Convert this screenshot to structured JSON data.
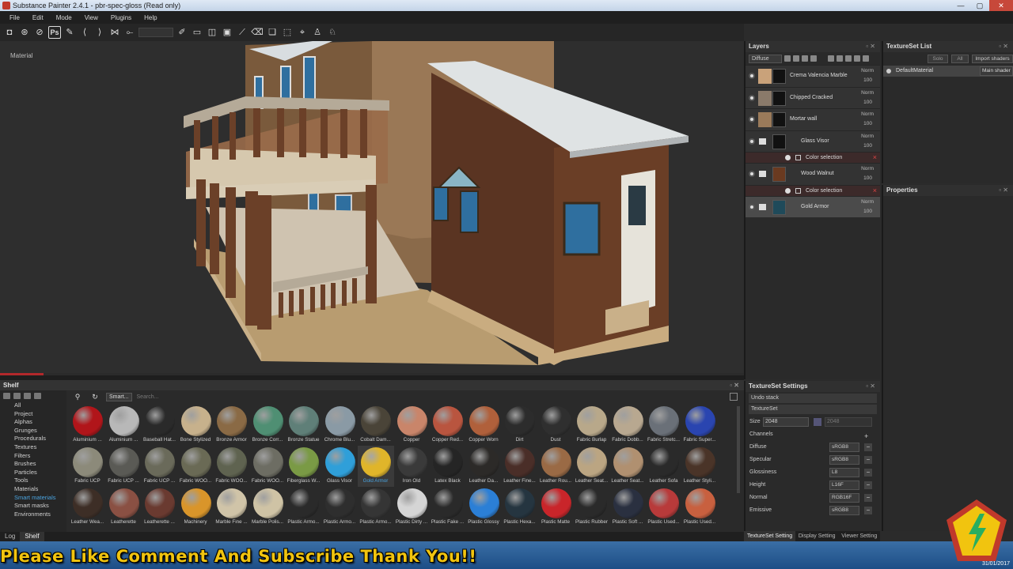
{
  "window": {
    "title": "Substance Painter 2.4.1 - pbr-spec-gloss (Read only)"
  },
  "menu": [
    "File",
    "Edit",
    "Mode",
    "View",
    "Plugins",
    "Help"
  ],
  "toolbar": {
    "photoshop_label": "Ps"
  },
  "viewport": {
    "label": "Material"
  },
  "shelf": {
    "title": "Shelf",
    "filter_chip": "Smart...",
    "search_placeholder": "Search...",
    "categories": [
      "All",
      "Project",
      "Alphas",
      "Grunges",
      "Procedurals",
      "Textures",
      "Filters",
      "Brushes",
      "Particles",
      "Tools",
      "Materials",
      "Smart materials",
      "Smart masks",
      "Environments"
    ],
    "selected_category": "Smart materials",
    "materials": [
      {
        "name": "Aluminium ...",
        "color": "#b1151a"
      },
      {
        "name": "Aluminium ...",
        "color": "#b8b8b8"
      },
      {
        "name": "Baseball Hat...",
        "color": "#2a2a2a"
      },
      {
        "name": "Bone Stylized",
        "color": "#c7b18c"
      },
      {
        "name": "Bronze Armor",
        "color": "#8a6a45"
      },
      {
        "name": "Bronze Corr...",
        "color": "#4f8f73"
      },
      {
        "name": "Bronze Statue",
        "color": "#5f7f78"
      },
      {
        "name": "Chrome Blu...",
        "color": "#8a9aa5"
      },
      {
        "name": "Cobalt Dam...",
        "color": "#4a4438"
      },
      {
        "name": "Copper",
        "color": "#c9856a"
      },
      {
        "name": "Copper Red...",
        "color": "#b9553f"
      },
      {
        "name": "Copper Worn",
        "color": "#b0603b"
      },
      {
        "name": "Dirt",
        "color": "#2c2c2c"
      },
      {
        "name": "Dust",
        "color": "#2f2f2f"
      },
      {
        "name": "Fabric Burlap",
        "color": "#b8a88a"
      },
      {
        "name": "Fabric Dobb...",
        "color": "#b8a890"
      },
      {
        "name": "Fabric Stretc...",
        "color": "#6a7078"
      },
      {
        "name": "Fabric Super...",
        "color": "#2a45b0"
      },
      {
        "name": "Fabric UCP",
        "color": "#8c8a7a"
      },
      {
        "name": "Fabric UCP ...",
        "color": "#5a5a55"
      },
      {
        "name": "Fabric UCP ...",
        "color": "#6a6a5a"
      },
      {
        "name": "Fabric WOO...",
        "color": "#6a6a55"
      },
      {
        "name": "Fabric WOO...",
        "color": "#5f6350"
      },
      {
        "name": "Fabric WOO...",
        "color": "#6d6d63"
      },
      {
        "name": "Fiberglass W...",
        "color": "#7a9a45"
      },
      {
        "name": "Glass Visor",
        "color": "#2f9fd9"
      },
      {
        "name": "Gold Armor",
        "color": "#e0b52a"
      },
      {
        "name": "Iron Old",
        "color": "#3a3a3a"
      },
      {
        "name": "Latex Black",
        "color": "#252525"
      },
      {
        "name": "Leather Da...",
        "color": "#2c2a28"
      },
      {
        "name": "Leather Fine...",
        "color": "#4a2e28"
      },
      {
        "name": "Leather Rou...",
        "color": "#9a6a45"
      },
      {
        "name": "Leather Seat...",
        "color": "#bba582"
      },
      {
        "name": "Leather Seat...",
        "color": "#b09070"
      },
      {
        "name": "Leather Sofa",
        "color": "#2a2a2a"
      },
      {
        "name": "Leather Styli...",
        "color": "#4a3428"
      },
      {
        "name": "Leather Wea...",
        "color": "#3d2e26"
      },
      {
        "name": "Leatherette",
        "color": "#8a5043"
      },
      {
        "name": "Leatherette ...",
        "color": "#6a3a30"
      },
      {
        "name": "Machinery",
        "color": "#d9952a"
      },
      {
        "name": "Marble Fine ...",
        "color": "#d0c4a8"
      },
      {
        "name": "Marble Polis...",
        "color": "#cfc3a5"
      },
      {
        "name": "Plastic Armo...",
        "color": "#2a2a2a"
      },
      {
        "name": "Plastic Armo...",
        "color": "#2e2e2e"
      },
      {
        "name": "Plastic Armo...",
        "color": "#353535"
      },
      {
        "name": "Plastic Dirty ...",
        "color": "#d5d5d5"
      },
      {
        "name": "Plastic Fake ...",
        "color": "#2a2a2a"
      },
      {
        "name": "Plastic Glossy",
        "color": "#2b7fd6"
      },
      {
        "name": "Plastic Hexa...",
        "color": "#253540"
      },
      {
        "name": "Plastic Matte",
        "color": "#c9252a"
      },
      {
        "name": "Plastic Rubber",
        "color": "#2a2a2a"
      },
      {
        "name": "Plastic Soft ...",
        "color": "#2a3040"
      },
      {
        "name": "Plastic Used...",
        "color": "#b83a3a"
      },
      {
        "name": "Plastic Used...",
        "color": "#c8603f"
      }
    ],
    "selected_material": "Gold Armor"
  },
  "bottom_tabs": [
    "Log",
    "Shelf"
  ],
  "layers": {
    "title": "Layers",
    "channel": "Diffuse",
    "items": [
      {
        "name": "Crema Valencia Marble",
        "blend": "Norm",
        "opacity": "100",
        "thumb": "#c9a27a",
        "kind": "fill"
      },
      {
        "name": "Chipped Cracked",
        "blend": "Norm",
        "opacity": "100",
        "thumb": "#8a7a6a",
        "kind": "fill"
      },
      {
        "name": "Mortar wall",
        "blend": "Norm",
        "opacity": "100",
        "thumb": "#9a7a5a",
        "kind": "fill"
      },
      {
        "name": "Glass Visor",
        "blend": "Norm",
        "opacity": "100",
        "thumb": "#111111",
        "kind": "folder",
        "sub": "Color selection"
      },
      {
        "name": "Wood Walnut",
        "blend": "Norm",
        "opacity": "100",
        "thumb": "#6a3a20",
        "kind": "folder",
        "sub": "Color selection"
      },
      {
        "name": "Gold Armor",
        "blend": "Norm",
        "opacity": "100",
        "thumb": "#1f4a5a",
        "kind": "folder"
      }
    ]
  },
  "textureset_list": {
    "title": "TextureSet List",
    "solo": "Solo",
    "all": "All",
    "import": "Import shaders",
    "item": "DefaultMaterial",
    "shader": "Main shader"
  },
  "properties": {
    "title": "Properties"
  },
  "textureset_settings": {
    "title": "TextureSet Settings",
    "undo": "Undo stack",
    "textureset": "TextureSet",
    "size_label": "Size",
    "size_value": "2048",
    "size_value2": "2048",
    "channels_label": "Channels",
    "channels": [
      {
        "name": "Diffuse",
        "format": "sRGB8"
      },
      {
        "name": "Specular",
        "format": "sRGB8"
      },
      {
        "name": "Glossiness",
        "format": "L8"
      },
      {
        "name": "Height",
        "format": "L16F"
      },
      {
        "name": "Normal",
        "format": "RGB16F"
      },
      {
        "name": "Emissive",
        "format": "sRGB8"
      }
    ]
  },
  "right_tabs": [
    "TextureSet Setting",
    "Display Setting",
    "Viewer Setting"
  ],
  "overlay_text": "Please Like Comment And Subscribe Thank You!!",
  "clock": "31/01/2017"
}
